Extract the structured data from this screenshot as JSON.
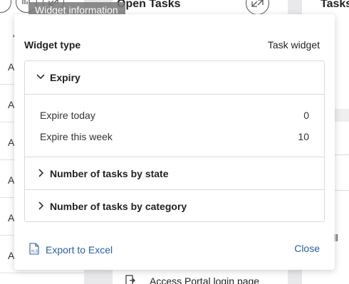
{
  "background": {
    "left_column_header": "A",
    "left_rows": [
      "A",
      "A",
      "A",
      "A",
      "A",
      "A"
    ],
    "middle_title": "Open Tasks",
    "right_title": "Tasks",
    "right_clear_text": "r all",
    "footer_item": "Access Portal login page"
  },
  "tooltip": {
    "text": "Widget information"
  },
  "dialog": {
    "widget_type_label": "Widget type",
    "widget_type_value": "Task widget",
    "sections": [
      {
        "title": "Expiry",
        "expanded": true,
        "rows": [
          {
            "label": "Expire today",
            "value": "0"
          },
          {
            "label": "Expire this week",
            "value": "10"
          }
        ]
      },
      {
        "title": "Number of tasks by state",
        "expanded": false
      },
      {
        "title": "Number of tasks by category",
        "expanded": false
      }
    ],
    "export_label": "Export to Excel",
    "close_label": "Close"
  },
  "colors": {
    "link": "#2a5fa3",
    "border": "#dadada"
  },
  "icons": {
    "expand": "chevron-down-icon",
    "collapsed": "chevron-right-icon",
    "export": "excel-file-icon"
  }
}
